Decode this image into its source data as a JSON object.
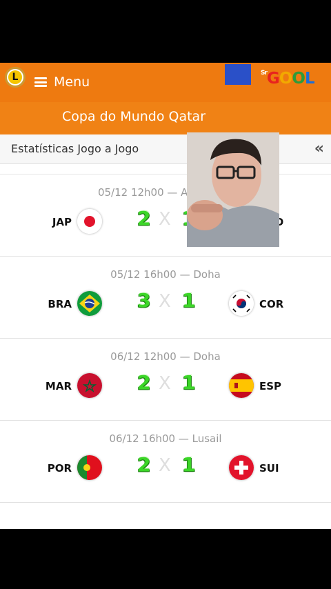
{
  "header": {
    "logo_letter": "L",
    "menu_label": "Menu",
    "brand_prefix": "Sr",
    "brand_text": [
      "G",
      "O",
      "O",
      "L"
    ]
  },
  "title_strip": {
    "title": "Copa do Mundo Qatar"
  },
  "subbar": {
    "title": "Estatísticas Jogo a Jogo",
    "collapse_icon": "double-chevron-left-icon"
  },
  "matches": [
    {
      "meta": "05/12 12h00 — Al-Wakrah",
      "home": "JAP",
      "away": "CRO",
      "home_score": "2",
      "away_score": "1",
      "separator": "X"
    },
    {
      "meta": "05/12 16h00 — Doha",
      "home": "BRA",
      "away": "COR",
      "home_score": "3",
      "away_score": "1",
      "separator": "X"
    },
    {
      "meta": "06/12 12h00 — Doha",
      "home": "MAR",
      "away": "ESP",
      "home_score": "2",
      "away_score": "1",
      "separator": "X"
    },
    {
      "meta": "06/12 16h00 — Lusail",
      "home": "POR",
      "away": "SUI",
      "home_score": "2",
      "away_score": "1",
      "separator": "X"
    }
  ],
  "colors": {
    "header_orange": "#ee7a10",
    "score_green": "#3cd628"
  }
}
